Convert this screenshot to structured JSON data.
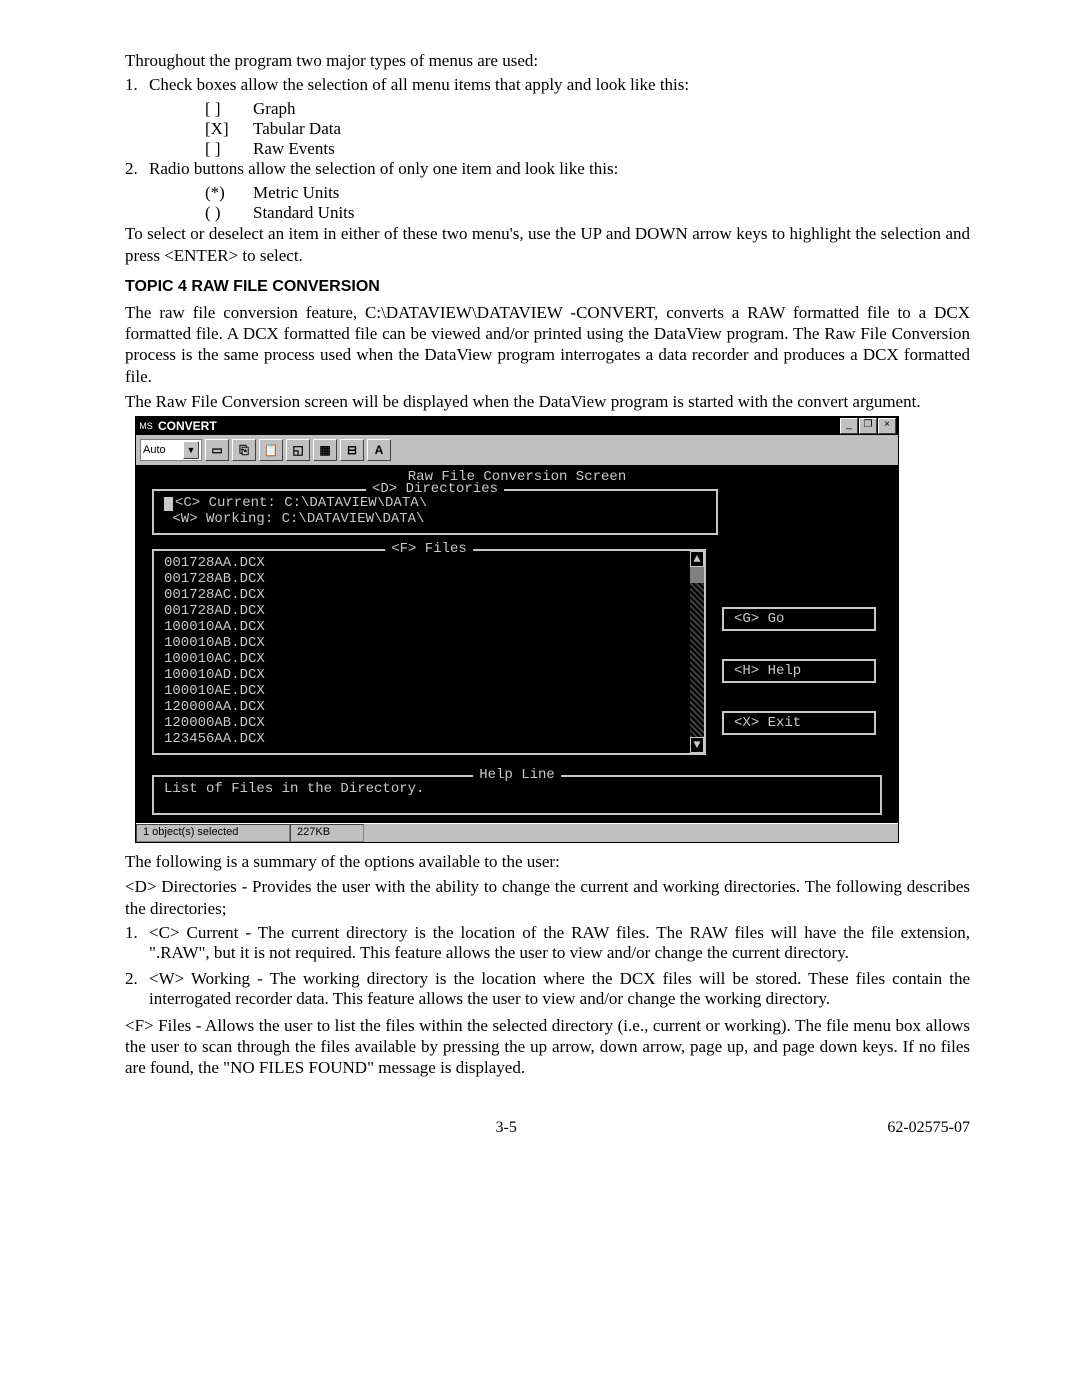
{
  "intro": "Throughout the program two major types of menus are used:",
  "li1": "Check boxes allow the selection of all menu items that apply and look like this:",
  "cb1_mark": "[ ]",
  "cb1_label": "Graph",
  "cb2_mark": "[X]",
  "cb2_label": "Tabular Data",
  "cb3_mark": "[ ]",
  "cb3_label": "Raw Events",
  "li2": "Radio buttons allow the selection of only one item and look like this:",
  "rb1_mark": "(*)",
  "rb1_label": "Metric Units",
  "rb2_mark": "( )",
  "rb2_label": "Standard Units",
  "para_select": "To select or deselect an item in either of these two menu's, use the UP and DOWN arrow keys to highlight the selection and press <ENTER> to select.",
  "topic_heading": "TOPIC 4    RAW FILE CONVERSION",
  "para_raw1": "The raw file conversion feature, C:\\DATAVIEW\\DATAVIEW -CONVERT, converts a RAW formatted file to a DCX formatted file. A DCX formatted file can be viewed and/or printed using the DataView program. The Raw File Conversion process is the same process used when the DataView program interrogates a data recorder and produces a DCX formatted file.",
  "para_raw2": "The Raw File Conversion screen will be displayed when the DataView program is started with the convert argument.",
  "win": {
    "title": "CONVERT",
    "combo": "Auto",
    "btn_min": "_",
    "btn_max": "❐",
    "btn_close": "×",
    "t_A": "A",
    "screen_title": "Raw File Conversion Screen",
    "dirs_legend": "<D> Directories",
    "dir_c": "<C> Current: C:\\DATAVIEW\\DATA\\",
    "dir_w": "<W> Working: C:\\DATAVIEW\\DATA\\",
    "files_legend": "<F> Files",
    "files": [
      "001728AA.DCX",
      "001728AB.DCX",
      "001728AC.DCX",
      "001728AD.DCX",
      "100010AA.DCX",
      "100010AB.DCX",
      "100010AC.DCX",
      "100010AD.DCX",
      "100010AE.DCX",
      "120000AA.DCX",
      "120000AB.DCX",
      "123456AA.DCX"
    ],
    "go": "<G> Go",
    "help": "<H> Help",
    "exit": "<X> Exit",
    "helpline_legend": "Help Line",
    "helpline_text": "List of Files in the Directory.",
    "status1": "1 object(s) selected",
    "status2": "227KB"
  },
  "summary_intro": "The following is a summary of the options available to the user:",
  "opt_d": "<D> Directories - Provides the user with the ability to change the current and working directories. The following describes the directories;",
  "opt_c_num": "1.",
  "opt_c": "<C> Current - The current directory is the location of the RAW files. The RAW files will have the file extension, \".RAW\", but it is not required. This feature allows the user to view and/or change the current directory.",
  "opt_w_num": "2.",
  "opt_w": "<W> Working - The working directory is the location where the DCX files will be stored. These files contain the interrogated recorder data. This feature allows the user to view and/or change the working directory.",
  "opt_f": "<F> Files - Allows the user to list the files within the selected directory (i.e., current or working). The file menu box allows the user to scan through the files available by pressing the up arrow, down arrow, page up, and page down keys. If no files are found, the \"NO FILES FOUND\" message is displayed.",
  "footer_page": "3-5",
  "footer_doc": "62-02575-07"
}
